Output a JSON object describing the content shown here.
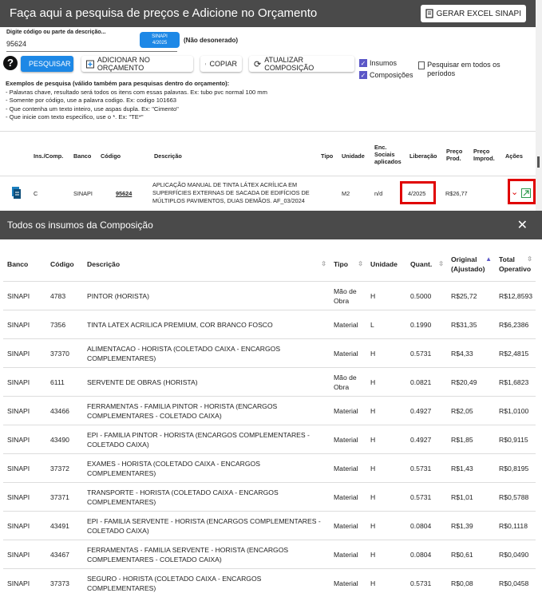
{
  "header": {
    "title": "Faça aqui a pesquisa de preços e Adicione no Orçamento",
    "excel_button": "GERAR EXCEL SINAPI"
  },
  "search": {
    "label": "Digite código ou parte da descrição...",
    "value": "95624",
    "sinapi_pill_line1": "SINAPI",
    "sinapi_pill_line2": "4/2025",
    "desonerado": "(Não desonerado)"
  },
  "buttons": {
    "pesquisar": "PESQUISAR",
    "adicionar": "ADICIONAR NO ORÇAMENTO",
    "copiar": "COPIAR",
    "atualizar": "ATUALIZAR COMPOSIÇÃO"
  },
  "checks": {
    "insumos": "Insumos",
    "composicoes": "Composições",
    "todos_periodos": "Pesquisar em todos os períodos"
  },
  "examples": {
    "head": "Exemplos de pesquisa (válido também para pesquisas dentro do orçamento):",
    "l1": "- Palavras chave, resultado será todos os itens com essas palavras. Ex: tubo pvc normal 100 mm",
    "l2": "- Somente por código, use a palavra codigo. Ex: codigo 101663",
    "l3": "- Que contenha um texto inteiro, use aspas dupla. Ex: \"Cimento\"",
    "l4": "- Que inicie com texto especifico, use o *. Ex: \"TE*\""
  },
  "results": {
    "headers": {
      "ins": "Ins./Comp.",
      "banco": "Banco",
      "codigo": "Código",
      "descricao": "Descrição",
      "tipo": "Tipo",
      "unidade": "Unidade",
      "enc1": "Enc.",
      "enc2": "Sociais",
      "enc3": "aplicados",
      "liberacao": "Liberação",
      "preco_prod1": "Preço",
      "preco_prod2": "Prod.",
      "preco_improd1": "Preço",
      "preco_improd2": "Improd.",
      "acoes": "Ações"
    },
    "row": {
      "ins": "C",
      "banco": "SINAPI",
      "codigo": "95624",
      "desc1": "APLICAÇÃO MANUAL DE TINTA LÁTEX ACRÍLICA EM",
      "desc2": "SUPERFÍCIES EXTERNAS DE SACADA DE EDIFÍCIOS DE",
      "desc3": "MÚLTIPLOS PAVIMENTOS, DUAS DEMÃOS. AF_03/2024",
      "unidade": "M2",
      "enc": "n/d",
      "liberacao": "4/2025",
      "preco_prod": "R$26,77"
    }
  },
  "modal": {
    "title": "Todos os insumos da Composição",
    "headers": {
      "banco": "Banco",
      "codigo": "Código",
      "descricao": "Descrição",
      "tipo": "Tipo",
      "unidade": "Unidade",
      "quant": "Quant.",
      "original1": "Original",
      "original2": "(Ajustado)",
      "total1": "Total",
      "total2": "Operativo"
    },
    "rows": [
      {
        "banco": "SINAPI",
        "codigo": "4783",
        "desc1": "PINTOR (HORISTA)",
        "desc2": "",
        "tipo1": "Mão de",
        "tipo2": "Obra",
        "un": "H",
        "quant": "0.5000",
        "orig": "R$25,72",
        "total": "R$12,8593"
      },
      {
        "banco": "SINAPI",
        "codigo": "7356",
        "desc1": "TINTA LATEX ACRILICA PREMIUM, COR BRANCO FOSCO",
        "desc2": "",
        "tipo1": "Material",
        "tipo2": "",
        "un": "L",
        "quant": "0.1990",
        "orig": "R$31,35",
        "total": "R$6,2386"
      },
      {
        "banco": "SINAPI",
        "codigo": "37370",
        "desc1": "ALIMENTACAO - HORISTA (COLETADO CAIXA - ENCARGOS",
        "desc2": "COMPLEMENTARES)",
        "tipo1": "Material",
        "tipo2": "",
        "un": "H",
        "quant": "0.5731",
        "orig": "R$4,33",
        "total": "R$2,4815"
      },
      {
        "banco": "SINAPI",
        "codigo": "6111",
        "desc1": "SERVENTE DE OBRAS (HORISTA)",
        "desc2": "",
        "tipo1": "Mão de",
        "tipo2": "Obra",
        "un": "H",
        "quant": "0.0821",
        "orig": "R$20,49",
        "total": "R$1,6823"
      },
      {
        "banco": "SINAPI",
        "codigo": "43466",
        "desc1": "FERRAMENTAS - FAMILIA PINTOR - HORISTA (ENCARGOS",
        "desc2": "COMPLEMENTARES - COLETADO CAIXA)",
        "tipo1": "Material",
        "tipo2": "",
        "un": "H",
        "quant": "0.4927",
        "orig": "R$2,05",
        "total": "R$1,0100"
      },
      {
        "banco": "SINAPI",
        "codigo": "43490",
        "desc1": "EPI - FAMILIA PINTOR - HORISTA (ENCARGOS COMPLEMENTARES -",
        "desc2": "COLETADO CAIXA)",
        "tipo1": "Material",
        "tipo2": "",
        "un": "H",
        "quant": "0.4927",
        "orig": "R$1,85",
        "total": "R$0,9115"
      },
      {
        "banco": "SINAPI",
        "codigo": "37372",
        "desc1": "EXAMES - HORISTA (COLETADO CAIXA - ENCARGOS",
        "desc2": "COMPLEMENTARES)",
        "tipo1": "Material",
        "tipo2": "",
        "un": "H",
        "quant": "0.5731",
        "orig": "R$1,43",
        "total": "R$0,8195"
      },
      {
        "banco": "SINAPI",
        "codigo": "37371",
        "desc1": "TRANSPORTE - HORISTA (COLETADO CAIXA - ENCARGOS",
        "desc2": "COMPLEMENTARES)",
        "tipo1": "Material",
        "tipo2": "",
        "un": "H",
        "quant": "0.5731",
        "orig": "R$1,01",
        "total": "R$0,5788"
      },
      {
        "banco": "SINAPI",
        "codigo": "43491",
        "desc1": "EPI - FAMILIA SERVENTE - HORISTA (ENCARGOS COMPLEMENTARES -",
        "desc2": "COLETADO CAIXA)",
        "tipo1": "Material",
        "tipo2": "",
        "un": "H",
        "quant": "0.0804",
        "orig": "R$1,39",
        "total": "R$0,1118"
      },
      {
        "banco": "SINAPI",
        "codigo": "43467",
        "desc1": "FERRAMENTAS - FAMILIA SERVENTE - HORISTA (ENCARGOS",
        "desc2": "COMPLEMENTARES - COLETADO CAIXA)",
        "tipo1": "Material",
        "tipo2": "",
        "un": "H",
        "quant": "0.0804",
        "orig": "R$0,61",
        "total": "R$0,0490"
      },
      {
        "banco": "SINAPI",
        "codigo": "37373",
        "desc1": "SEGURO - HORISTA (COLETADO CAIXA - ENCARGOS",
        "desc2": "COMPLEMENTARES)",
        "tipo1": "Material",
        "tipo2": "",
        "un": "H",
        "quant": "0.5731",
        "orig": "R$0,08",
        "total": "R$0,0458"
      }
    ]
  },
  "colors": {
    "accent": "#1d88e6",
    "header_bg": "#4a4a4a",
    "check": "#5b57c7",
    "highlight": "#e00000"
  }
}
